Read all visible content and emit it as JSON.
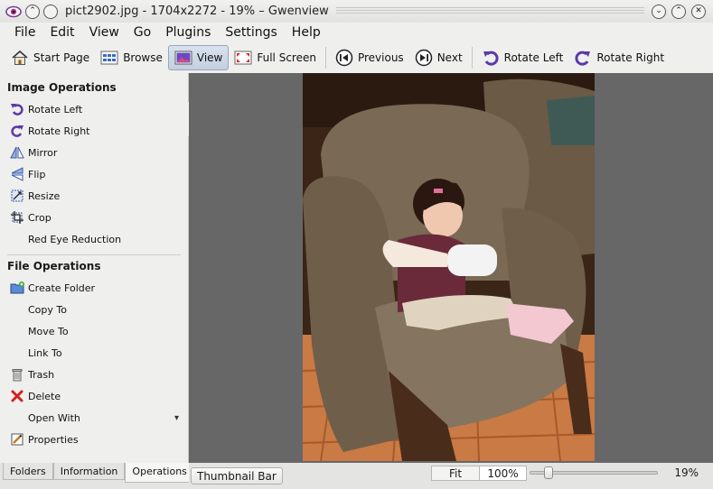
{
  "window": {
    "title": "pict2902.jpg - 1704x2272 - 19% – Gwenview"
  },
  "menu": [
    "File",
    "Edit",
    "View",
    "Go",
    "Plugins",
    "Settings",
    "Help"
  ],
  "toolbar": {
    "start_page": "Start Page",
    "browse": "Browse",
    "view": "View",
    "full_screen": "Full Screen",
    "previous": "Previous",
    "next": "Next",
    "rotate_left": "Rotate Left",
    "rotate_right": "Rotate Right"
  },
  "sidebar": {
    "image_ops_title": "Image Operations",
    "image_ops": [
      "Rotate Left",
      "Rotate Right",
      "Mirror",
      "Flip",
      "Resize",
      "Crop",
      "Red Eye Reduction"
    ],
    "file_ops_title": "File Operations",
    "file_ops": [
      "Create Folder",
      "Copy To",
      "Move To",
      "Link To",
      "Trash",
      "Delete",
      "Open With",
      "Properties"
    ],
    "tabs": [
      "Folders",
      "Information",
      "Operations"
    ],
    "selected_tab": "Operations"
  },
  "status": {
    "thumbnail_bar": "Thumbnail Bar",
    "fit": "Fit",
    "hundred": "100%",
    "zoom_value": 0.19,
    "zoom_percent": "19%"
  },
  "colors": {
    "accent_purple": "#5a3aa8",
    "viewer_bg": "#676767"
  }
}
